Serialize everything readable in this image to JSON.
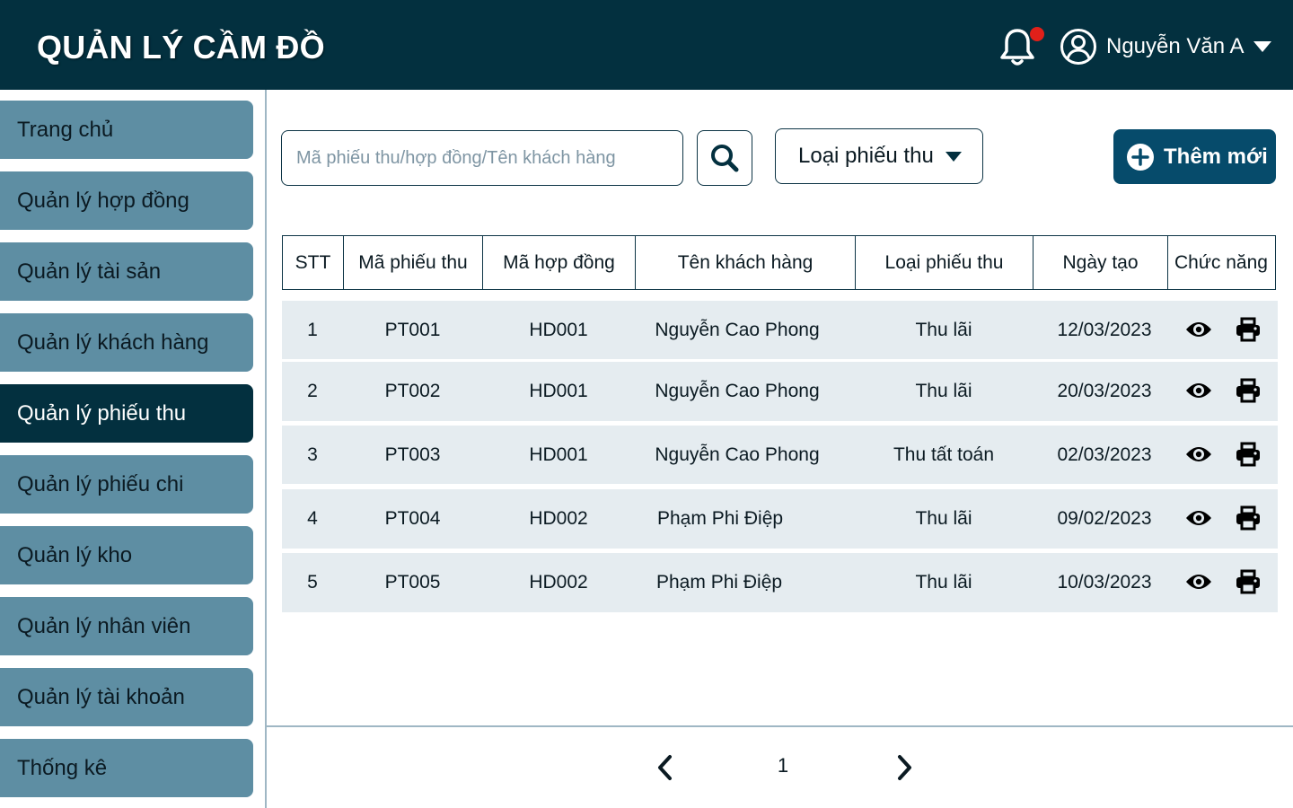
{
  "header": {
    "title": "QUẢN LÝ CẦM ĐỒ",
    "user_name": "Nguyễn Văn A",
    "notification_icon": "bell-icon",
    "user_icon": "user-circle-icon"
  },
  "sidebar": {
    "items": [
      {
        "label": "Trang chủ",
        "active": false
      },
      {
        "label": "Quản lý hợp đồng",
        "active": false
      },
      {
        "label": "Quản lý tài sản",
        "active": false
      },
      {
        "label": "Quản lý khách hàng",
        "active": false
      },
      {
        "label": "Quản lý phiếu thu",
        "active": true
      },
      {
        "label": "Quản lý phiếu chi",
        "active": false
      },
      {
        "label": "Quản lý kho",
        "active": false
      },
      {
        "label": "Quản lý nhân viên",
        "active": false
      },
      {
        "label": "Quản lý tài khoản",
        "active": false
      },
      {
        "label": "Thống kê",
        "active": false
      }
    ]
  },
  "toolbar": {
    "search_placeholder": "Mã phiếu thu/hợp đồng/Tên khách hàng",
    "type_filter_label": "Loại phiếu thu",
    "add_label": "Thêm mới"
  },
  "table": {
    "headers": [
      "STT",
      "Mã phiếu thu",
      "Mã hợp đồng",
      "Tên khách hàng",
      "Loại phiếu thu",
      "Ngày tạo",
      "Chức năng"
    ],
    "rows": [
      {
        "stt": "1",
        "receipt_id": "PT001",
        "contract_id": "HD001",
        "customer": "Nguyễn Cao Phong",
        "type": "Thu lãi",
        "date": "12/03/2023"
      },
      {
        "stt": "2",
        "receipt_id": "PT002",
        "contract_id": "HD001",
        "customer": "Nguyễn Cao Phong",
        "type": "Thu lãi",
        "date": "20/03/2023"
      },
      {
        "stt": "3",
        "receipt_id": "PT003",
        "contract_id": "HD001",
        "customer": "Nguyễn Cao Phong",
        "type": "Thu tất toán",
        "date": "02/03/2023"
      },
      {
        "stt": "4",
        "receipt_id": "PT004",
        "contract_id": "HD002",
        "customer": "Phạm Phi Điệp",
        "type": "Thu lãi",
        "date": "09/02/2023"
      },
      {
        "stt": "5",
        "receipt_id": "PT005",
        "contract_id": "HD002",
        "customer": "Phạm Phi Điệp",
        "type": "Thu lãi",
        "date": "10/03/2023"
      }
    ]
  },
  "pagination": {
    "current_page": "1"
  },
  "colors": {
    "header_bg": "#03303f",
    "sidebar_item": "#5e8ea3",
    "sidebar_active": "#03303f",
    "primary_button": "#064b6b",
    "row_bg": "#e5ecf0",
    "notification_dot": "#e0201a"
  }
}
